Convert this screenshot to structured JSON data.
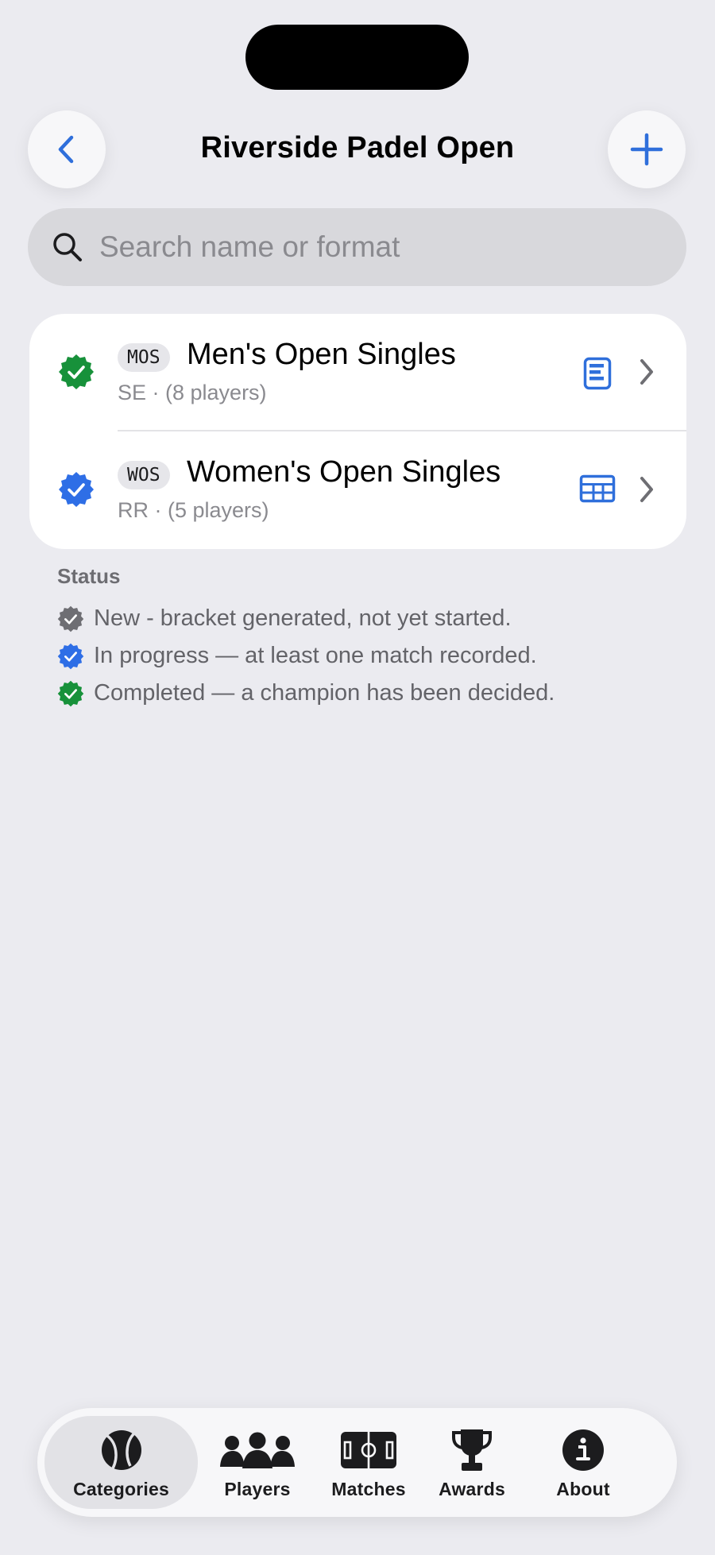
{
  "header": {
    "title": "Riverside Padel Open",
    "back_icon": "chevron-left-icon",
    "add_icon": "plus-icon"
  },
  "search": {
    "placeholder": "Search name or format",
    "value": ""
  },
  "categories": [
    {
      "abbr": "MOS",
      "name": "Men's Open Singles",
      "subtitle": "SE · (8 players)",
      "status": "completed",
      "format_icon": "bracket-icon"
    },
    {
      "abbr": "WOS",
      "name": "Women's Open Singles",
      "subtitle": "RR · (5 players)",
      "status": "in-progress",
      "format_icon": "table-grid-icon"
    }
  ],
  "legend": {
    "title": "Status",
    "items": [
      {
        "status": "new",
        "text": "New - bracket generated, not yet started."
      },
      {
        "status": "in-progress",
        "text": "In progress — at least one match recorded."
      },
      {
        "status": "completed",
        "text": "Completed — a champion has been decided."
      }
    ]
  },
  "tabs": [
    {
      "label": "Categories",
      "icon": "tennis-ball-icon",
      "active": true
    },
    {
      "label": "Players",
      "icon": "people-icon",
      "active": false
    },
    {
      "label": "Matches",
      "icon": "court-icon",
      "active": false
    },
    {
      "label": "Awards",
      "icon": "trophy-icon",
      "active": false
    },
    {
      "label": "About",
      "icon": "info-icon",
      "active": false
    }
  ],
  "colors": {
    "accent": "#2f6fdb",
    "completed": "#17913a",
    "in_progress": "#2e6ee6",
    "new": "#6e6e73",
    "background": "#ebebf0"
  }
}
